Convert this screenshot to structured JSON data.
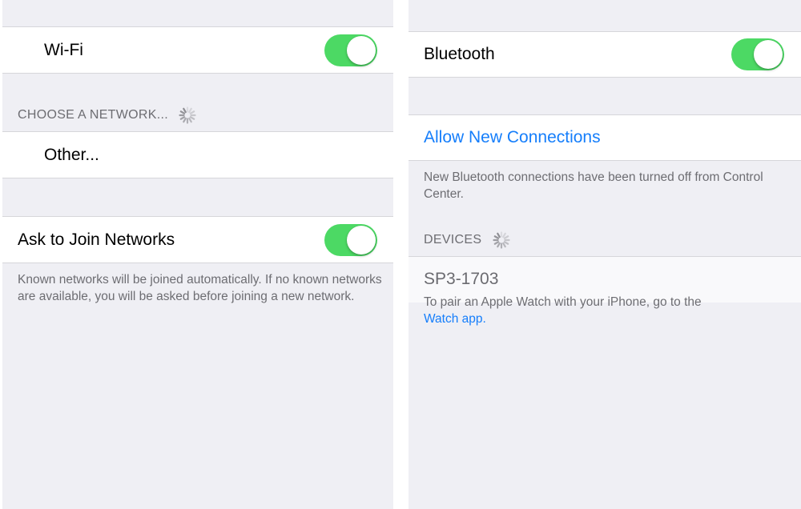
{
  "wifi_screen": {
    "wifi_toggle": {
      "label": "Wi-Fi",
      "on": true
    },
    "choose_network_header": "CHOOSE A NETWORK...",
    "other_item": "Other...",
    "ask_to_join": {
      "label": "Ask to Join Networks",
      "on": true
    },
    "ask_to_join_footnote": "Known networks will be joined automatically. If no known networks are available, you will be asked before joining a new network."
  },
  "bluetooth_screen": {
    "bluetooth_toggle": {
      "label": "Bluetooth",
      "on": true
    },
    "allow_connections": "Allow New Connections",
    "allow_connections_footnote": "New Bluetooth connections have been turned off from Control Center.",
    "devices_header": "DEVICES",
    "devices": [
      {
        "name": "SP3-1703"
      }
    ],
    "watch_note": "To pair an Apple Watch with your iPhone, go to the",
    "watch_link": "Watch app."
  },
  "colors": {
    "toggle_on": "#4cd964",
    "link": "#157efb",
    "background": "#efeff4",
    "secondary_text": "#6d6d72"
  },
  "icons": {
    "loading": "activity-spinner-icon"
  }
}
